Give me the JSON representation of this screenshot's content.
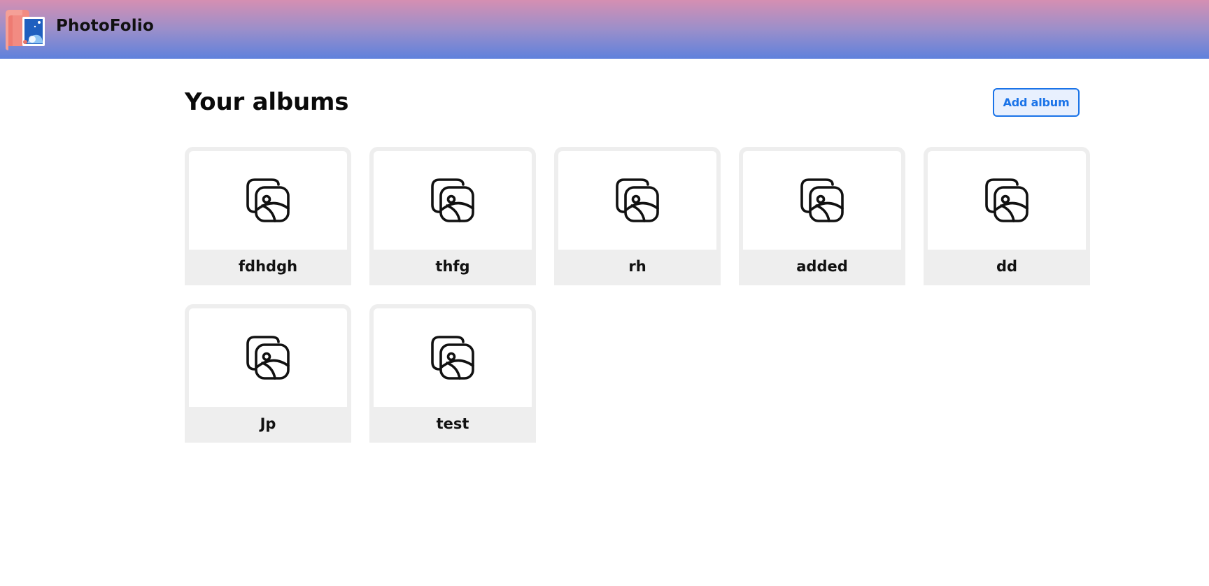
{
  "navbar": {
    "brand": "PhotoFolio",
    "logo_icon": "photo-album-logo-icon",
    "gradient_top": "#d58fb2",
    "gradient_bottom": "#5f81dc"
  },
  "main": {
    "title": "Your albums",
    "add_button_label": "Add album",
    "accent_color": "#1a73e8"
  },
  "albums": [
    {
      "name": "fdhdgh",
      "icon": "photo-gallery-icon"
    },
    {
      "name": "thfg",
      "icon": "photo-gallery-icon"
    },
    {
      "name": "rh",
      "icon": "photo-gallery-icon"
    },
    {
      "name": "added",
      "icon": "photo-gallery-icon"
    },
    {
      "name": "dd",
      "icon": "photo-gallery-icon"
    },
    {
      "name": "Jp",
      "icon": "photo-gallery-icon"
    },
    {
      "name": "test",
      "icon": "photo-gallery-icon"
    }
  ]
}
